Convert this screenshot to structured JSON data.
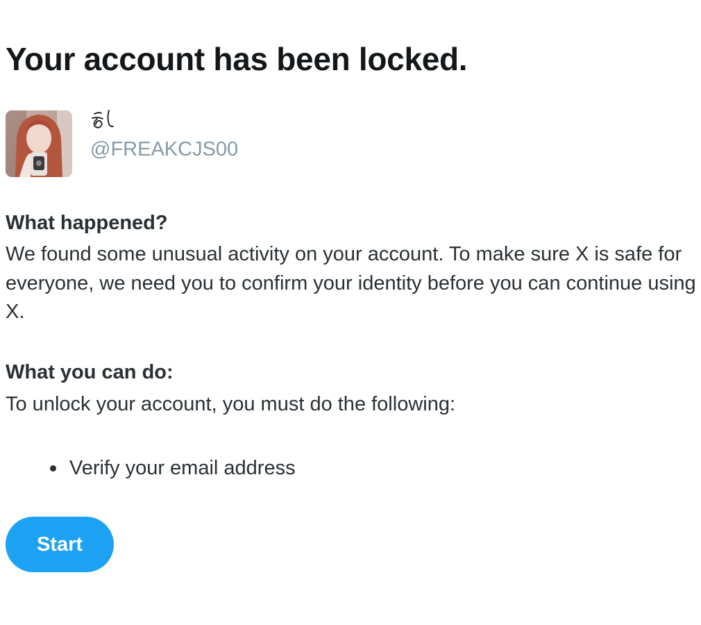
{
  "page": {
    "title": "Your account has been locked."
  },
  "profile": {
    "display_name": "ㅎㅣ",
    "handle": "@FREAKCJS00"
  },
  "what_happened": {
    "heading": "What happened?",
    "body": "We found some unusual activity on your account. To make sure X is safe for everyone, we need you to confirm your identity before you can continue using X."
  },
  "what_you_can_do": {
    "heading": "What you can do:",
    "body": "To unlock your account, you must do the following:",
    "steps": [
      "Verify your email address"
    ]
  },
  "actions": {
    "start_label": "Start"
  },
  "colors": {
    "accent": "#1da1f2",
    "handle": "#8899a6",
    "text": "#292f33"
  }
}
